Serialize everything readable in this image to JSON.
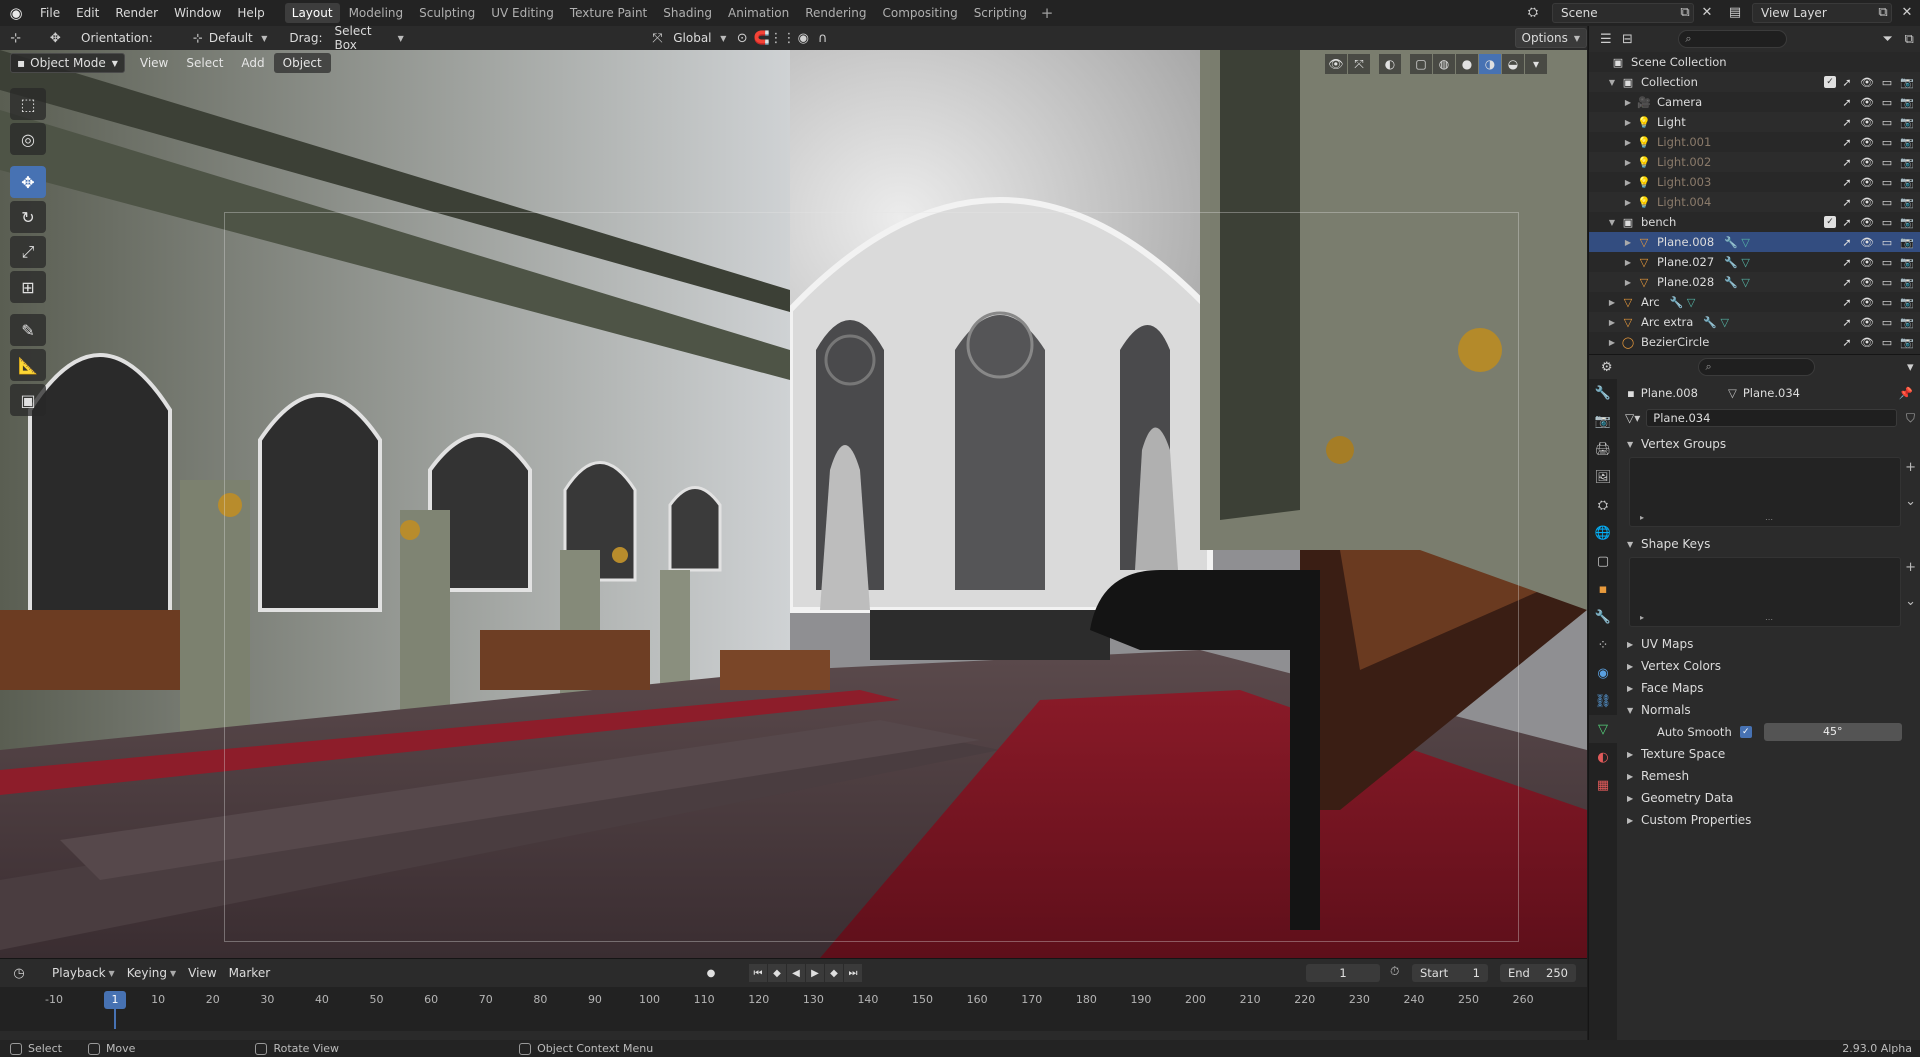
{
  "menubar": {
    "items": [
      "File",
      "Edit",
      "Render",
      "Window",
      "Help"
    ],
    "workspaces": [
      "Layout",
      "Modeling",
      "Sculpting",
      "UV Editing",
      "Texture Paint",
      "Shading",
      "Animation",
      "Rendering",
      "Compositing",
      "Scripting"
    ],
    "active_workspace": "Layout",
    "scene_label": "Scene",
    "view_layer_label": "View Layer"
  },
  "viewport_header": {
    "orientation_label": "Orientation:",
    "orientation_value": "Default",
    "drag_label": "Drag:",
    "drag_value": "Select Box",
    "transform_orientation": "Global",
    "options_label": "Options"
  },
  "viewport_menu": {
    "mode": "Object Mode",
    "view": "View",
    "select": "Select",
    "add": "Add",
    "object": "Object"
  },
  "tools": [
    {
      "name": "select-box-tool",
      "glyph": "⬚"
    },
    {
      "name": "cursor-tool",
      "glyph": "◎"
    },
    {
      "name": "move-tool",
      "glyph": "✥",
      "active": true
    },
    {
      "name": "rotate-tool",
      "glyph": "↻"
    },
    {
      "name": "scale-tool",
      "glyph": "⤢"
    },
    {
      "name": "transform-tool",
      "glyph": "⊞"
    },
    {
      "name": "annotate-tool",
      "glyph": "✎"
    },
    {
      "name": "measure-tool",
      "glyph": "📐"
    },
    {
      "name": "add-cube-tool",
      "glyph": "▣"
    }
  ],
  "outliner": {
    "root": "Scene Collection",
    "rows": [
      {
        "name": "Collection",
        "depth": 1,
        "icon": "▣",
        "kind": "collection",
        "expanded": true,
        "checked": true
      },
      {
        "name": "Camera",
        "depth": 2,
        "icon": "🎥",
        "kind": "object"
      },
      {
        "name": "Light",
        "depth": 2,
        "icon": "💡",
        "kind": "object"
      },
      {
        "name": "Light.001",
        "depth": 2,
        "icon": "💡",
        "kind": "object",
        "dim": true
      },
      {
        "name": "Light.002",
        "depth": 2,
        "icon": "💡",
        "kind": "object",
        "dim": true
      },
      {
        "name": "Light.003",
        "depth": 2,
        "icon": "💡",
        "kind": "object",
        "dim": true
      },
      {
        "name": "Light.004",
        "depth": 2,
        "icon": "💡",
        "kind": "object",
        "dim": true
      },
      {
        "name": "bench",
        "depth": 1,
        "icon": "▣",
        "kind": "collection",
        "expanded": true,
        "checked": true
      },
      {
        "name": "Plane.008",
        "depth": 2,
        "icon": "▽",
        "kind": "mesh",
        "selected": true
      },
      {
        "name": "Plane.027",
        "depth": 2,
        "icon": "▽",
        "kind": "mesh"
      },
      {
        "name": "Plane.028",
        "depth": 2,
        "icon": "▽",
        "kind": "mesh"
      },
      {
        "name": "Arc",
        "depth": 1,
        "icon": "▽",
        "kind": "mesh"
      },
      {
        "name": "Arc extra",
        "depth": 1,
        "icon": "▽",
        "kind": "mesh"
      },
      {
        "name": "BezierCircle",
        "depth": 1,
        "icon": "◯",
        "kind": "curve"
      }
    ]
  },
  "properties": {
    "object_name": "Plane.008",
    "mesh_name": "Plane.034",
    "mesh_field_value": "Plane.034",
    "vertex_groups": "Vertex Groups",
    "shape_keys": "Shape Keys",
    "uv_maps": "UV Maps",
    "vertex_colors": "Vertex Colors",
    "face_maps": "Face Maps",
    "normals": "Normals",
    "auto_smooth_label": "Auto Smooth",
    "auto_smooth_angle": "45°",
    "texture_space": "Texture Space",
    "remesh": "Remesh",
    "geometry_data": "Geometry Data",
    "custom_properties": "Custom Properties"
  },
  "timeline": {
    "playback": "Playback",
    "keying": "Keying",
    "view": "View",
    "marker": "Marker",
    "current_frame": "1",
    "start_label": "Start",
    "start_value": "1",
    "end_label": "End",
    "end_value": "250",
    "ticks": [
      "-10",
      "10",
      "20",
      "30",
      "40",
      "50",
      "60",
      "70",
      "80",
      "90",
      "100",
      "110",
      "120",
      "130",
      "140",
      "150",
      "160",
      "170",
      "180",
      "190",
      "200",
      "210",
      "220",
      "230",
      "240",
      "250",
      "260"
    ]
  },
  "statusbar": {
    "select": "Select",
    "move": "Move",
    "rotate_view": "Rotate View",
    "context_menu": "Object Context Menu",
    "version": "2.93.0 Alpha"
  }
}
